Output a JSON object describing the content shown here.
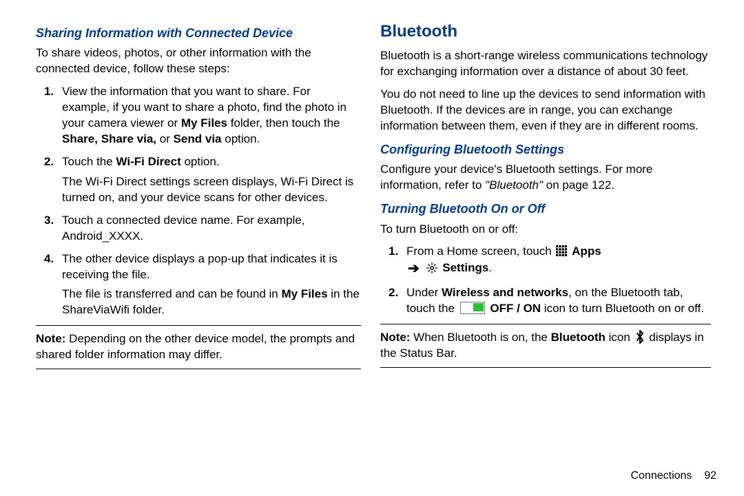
{
  "left": {
    "heading": "Sharing Information with Connected Device",
    "intro": "To share videos, photos, or other information with the connected device, follow these steps:",
    "steps": [
      {
        "n": "1.",
        "t1": "View the information that you want to share. For example, if you want to share a photo, find the photo in your camera viewer or ",
        "b1": "My Files",
        "t2": " folder, then touch the ",
        "b2": "Share, Share via,",
        "t3": " or ",
        "b3": "Send via",
        "t4": " option."
      },
      {
        "n": "2.",
        "t1": "Touch the ",
        "b1": "Wi-Fi Direct",
        "t2": " option.",
        "sub": "The Wi-Fi Direct settings screen displays, Wi-Fi Direct is turned on, and your device scans for other devices."
      },
      {
        "n": "3.",
        "t1": "Touch a connected device name. For example, Android_XXXX."
      },
      {
        "n": "4.",
        "t1": "The other device displays a pop-up that indicates it is receiving the file.",
        "sub_pre": "The file is transferred and can be found in ",
        "sub_b": "My Files",
        "sub_post": " in the ShareViaWifi folder."
      }
    ],
    "note_label": "Note:",
    "note_text": " Depending on the other device model, the prompts and shared folder information may differ."
  },
  "right": {
    "title": "Bluetooth",
    "p1": "Bluetooth is a short-range wireless communications technology for exchanging information over a distance of about 30 feet.",
    "p2": "You do not need to line up the devices to send information with Bluetooth. If the devices are in range, you can exchange information between them, even if they are in different rooms.",
    "h_config": "Configuring Bluetooth Settings",
    "config_t1": "Configure your device's Bluetooth settings. For more information, refer to ",
    "config_i": "\"Bluetooth\"",
    "config_t2": " on page 122.",
    "h_turn": "Turning Bluetooth On or Off",
    "turn_intro": "To turn Bluetooth on or off:",
    "turn_steps": [
      {
        "n": "1.",
        "t1": "From a Home screen, touch ",
        "apps": "Apps",
        "settings": "Settings",
        "period": "."
      },
      {
        "n": "2.",
        "t1": "Under ",
        "b1": "Wireless and networks",
        "t2": ", on the Bluetooth tab, touch the ",
        "b2": "OFF / ON",
        "t3": " icon to turn Bluetooth on or off."
      }
    ],
    "note_label": "Note:",
    "note_t1": " When Bluetooth is on, the ",
    "note_b": "Bluetooth",
    "note_t2": " icon ",
    "note_t3": " displays in the Status Bar."
  },
  "footer": {
    "section": "Connections",
    "page": "92"
  }
}
